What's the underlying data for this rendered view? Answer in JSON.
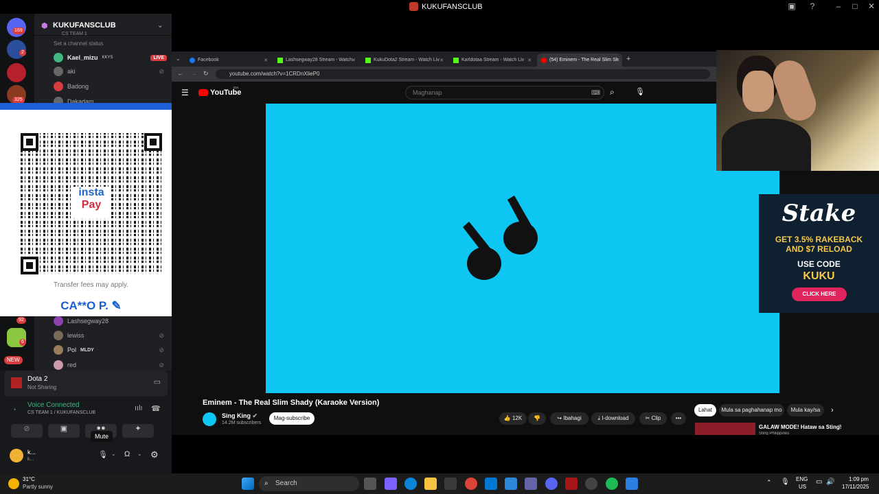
{
  "window": {
    "title": "KUKUFANSCLUB"
  },
  "servers": {
    "badges": [
      "169",
      "2",
      "325",
      "92",
      "6"
    ],
    "new_label": "NEW"
  },
  "channel": {
    "server_name": "KUKUFANSCLUB",
    "team_label": "CS TEAM 1",
    "status": "Set a channel status",
    "members": [
      {
        "name": "Kael_mizu",
        "tag": "KKYS",
        "live": "LIVE"
      },
      {
        "name": "aki"
      },
      {
        "name": "Badong"
      },
      {
        "name": "Dakadam"
      },
      {
        "name": "Lashsegway28"
      },
      {
        "name": "lewiss"
      },
      {
        "name": "Pol",
        "tag": "MLDY"
      },
      {
        "name": "red"
      }
    ]
  },
  "qr_overlay": {
    "logo_top": "insta",
    "logo_bottom": "Pay",
    "fee_note": "Transfer fees may apply.",
    "owner": "CA**O P."
  },
  "discord_bottom": {
    "game": "Dota 2",
    "sharing": "Not Sharing",
    "voice_status": "Voice Connected",
    "voice_channel": "CS TEAM 1 / KUKUFANSCLUB",
    "tooltip": "Mute",
    "user": "k...",
    "user_sub": "k..."
  },
  "browser": {
    "tabs": [
      {
        "label": "Facebook",
        "color": "#1877f2"
      },
      {
        "label": "Lashsegway28 Stream - Watch",
        "color": "#53fc18"
      },
      {
        "label": "KukuDota2 Stream - Watch Liv",
        "color": "#53fc18"
      },
      {
        "label": "Karldotaa Stream - Watch Liv",
        "color": "#53fc18"
      },
      {
        "label": "(54) Eminem - The Real Slim Sh",
        "color": "#ff0000"
      }
    ],
    "url": "youtube.com/watch?v=1CRDnXlieP0"
  },
  "youtube": {
    "logo": "YouTube",
    "region": "PH",
    "search_placeholder": "Maghanap",
    "video_title": "Eminem - The Real Slim Shady (Karaoke Version)",
    "channel": "Sing King",
    "subscribers": "14.2M subscribers",
    "subscribe": "Mag-subscribe",
    "likes": "12K",
    "share": "Ibahagi",
    "download": "I-download",
    "clip": "Clip",
    "chips": [
      "Lahat",
      "Mula sa paghahanap mo",
      "Mula kay/sa"
    ],
    "rec_title": "GALAW MODE! Hataw sa Sting!",
    "rec_channel": "Sting Philippines"
  },
  "stake_ad": {
    "brand": "Stake",
    "line1": "GET 3.5% RAKEBACK",
    "line2": "AND $7 RELOAD",
    "use_code": "USE CODE",
    "code": "KUKU",
    "cta": "CLICK HERE"
  },
  "taskbar": {
    "temp": "31°C",
    "weather": "Partly sunny",
    "search": "Search",
    "lang1": "ENG",
    "lang2": "US",
    "time": "1:09 pm",
    "date": "17/11/2025"
  }
}
